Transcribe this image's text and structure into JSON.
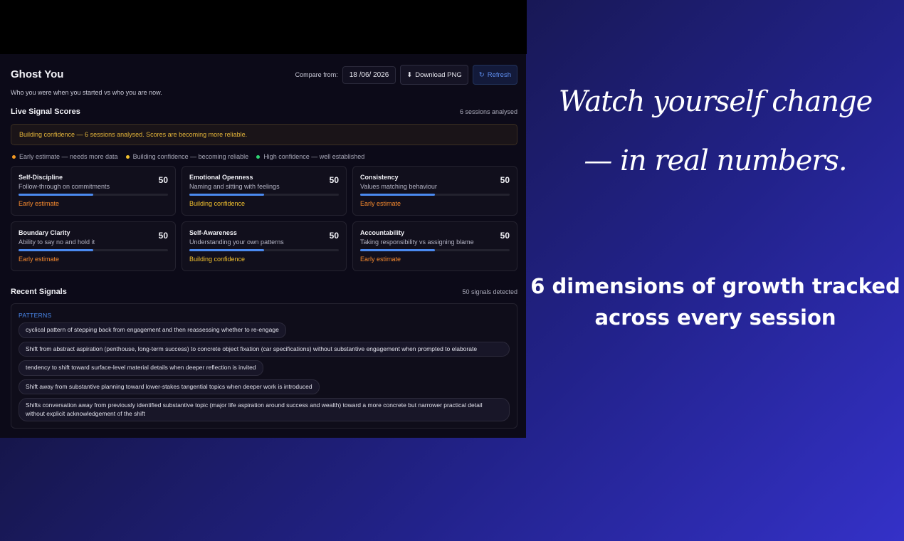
{
  "app": {
    "title": "Ghost You",
    "subtitle": "Who you were when you started vs who you are now.",
    "compare_label": "Compare from:",
    "compare_date": "18 /06/ 2026",
    "download_label": "Download PNG",
    "refresh_label": "Refresh"
  },
  "scores": {
    "title": "Live Signal Scores",
    "sessions": "6 sessions analysed",
    "banner": "Building confidence — 6 sessions analysed. Scores are becoming more reliable.",
    "legend": [
      {
        "label": "Early estimate — needs more data",
        "color": "#f59a22"
      },
      {
        "label": "Building confidence — becoming reliable",
        "color": "#f2c12e"
      },
      {
        "label": "High confidence — well established",
        "color": "#2ed573"
      }
    ],
    "cards": [
      {
        "name": "Self-Discipline",
        "desc": "Follow-through on commitments",
        "score": "50",
        "level": 0.5,
        "status": "Early estimate",
        "status_color": "#f5892e"
      },
      {
        "name": "Emotional Openness",
        "desc": "Naming and sitting with feelings",
        "score": "50",
        "level": 0.5,
        "status": "Building confidence",
        "status_color": "#f2c12e"
      },
      {
        "name": "Consistency",
        "desc": "Values matching behaviour",
        "score": "50",
        "level": 0.5,
        "status": "Early estimate",
        "status_color": "#f5892e"
      },
      {
        "name": "Boundary Clarity",
        "desc": "Ability to say no and hold it",
        "score": "50",
        "level": 0.5,
        "status": "Early estimate",
        "status_color": "#f5892e"
      },
      {
        "name": "Self-Awareness",
        "desc": "Understanding your own patterns",
        "score": "50",
        "level": 0.5,
        "status": "Building confidence",
        "status_color": "#f2c12e"
      },
      {
        "name": "Accountability",
        "desc": "Taking responsibility vs assigning blame",
        "score": "50",
        "level": 0.5,
        "status": "Early estimate",
        "status_color": "#f5892e"
      }
    ]
  },
  "signals": {
    "title": "Recent Signals",
    "count": "50 signals detected",
    "patterns_label": "PATTERNS",
    "items": [
      "cyclical pattern of stepping back from engagement and then reassessing whether to re-engage",
      "Shift from abstract aspiration (penthouse, long-term success) to concrete object fixation (car specifications) without substantive engagement when prompted to elaborate",
      "tendency to shift toward surface-level material details when deeper reflection is invited",
      "Shift away from substantive planning toward lower-stakes tangential topics when deeper work is introduced",
      "Shifts conversation away from previously identified substantive topic (major life aspiration around success and wealth) toward a more concrete but narrower practical detail without explicit acknowledgement of the shift"
    ]
  },
  "marketing": {
    "headline_1": "Watch yourself change",
    "headline_2": "— in real numbers.",
    "tagline_1": "6 dimensions of growth tracked",
    "tagline_2": "across every session"
  },
  "icons": {
    "download": "download-arrow-icon",
    "refresh": "refresh-icon"
  }
}
